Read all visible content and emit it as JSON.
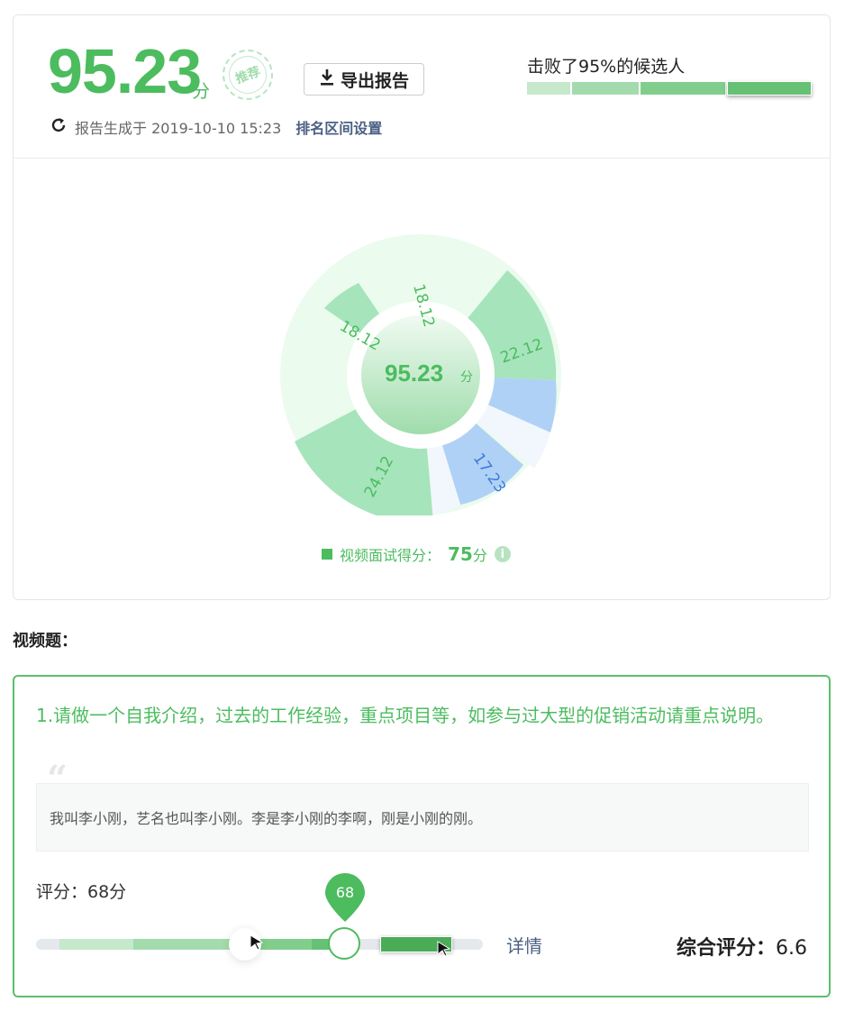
{
  "header": {
    "score": "95.23",
    "score_unit": "分",
    "stamp_text": "推荐",
    "export_label": "导出报告",
    "generated_text": "报告生成于 2019-10-10 15:23",
    "rank_setting_label": "排名区间设置",
    "beat_text": "击败了95%的候选人",
    "beat_percent": 95
  },
  "chart_data": {
    "type": "pie",
    "center_value": "95.23",
    "center_unit": "分",
    "segments": [
      {
        "label": "18.12",
        "value": 18.12
      },
      {
        "label": "22.12",
        "value": 22.12
      },
      {
        "label": "17.23",
        "value": 17.23
      },
      {
        "label": "24.12",
        "value": 24.12
      },
      {
        "label": "18.12",
        "value": 18.12
      }
    ],
    "legend": {
      "label": "视频面试得分：",
      "value": "75",
      "unit": "分"
    }
  },
  "section": {
    "title": "视频题："
  },
  "question": {
    "text": "1.请做一个自我介绍，过去的工作经验，重点项目等，如参与过大型的促销活动请重点说明。",
    "answer": "我叫李小刚，艺名也叫李小刚。李是李小刚的李啊，刚是小刚的刚。",
    "rating_label": "评分：68分",
    "slider_value": "68",
    "detail_label": "详情",
    "overall_label": "综合评分：",
    "overall_value": "6.6"
  },
  "colors": {
    "accent": "#4cbc5f",
    "link": "#4b6084",
    "blue": "#b0d1f6"
  }
}
